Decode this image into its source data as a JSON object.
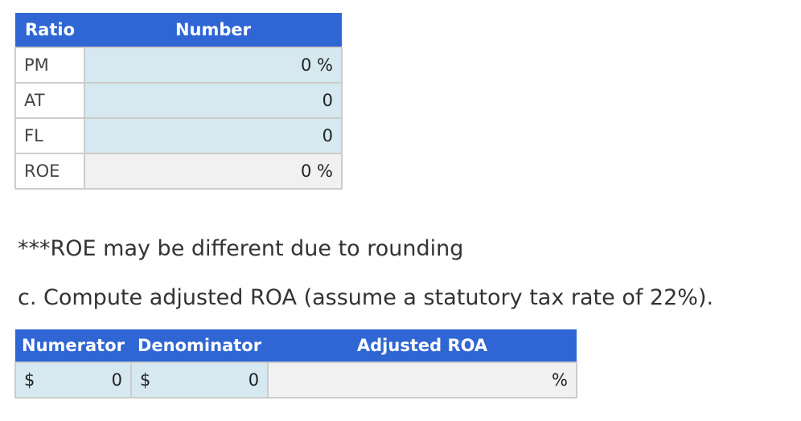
{
  "ratio_table": {
    "headers": {
      "ratio": "Ratio",
      "number": "Number"
    },
    "rows": [
      {
        "label": "PM",
        "value": "0 %",
        "kind": "input"
      },
      {
        "label": "AT",
        "value": "0",
        "kind": "input"
      },
      {
        "label": "FL",
        "value": "0",
        "kind": "input"
      },
      {
        "label": "ROE",
        "value": "0 %",
        "kind": "output"
      }
    ]
  },
  "notes": {
    "rounding": "***ROE may be different due to rounding",
    "question_c": "c. Compute adjusted ROA (assume a statutory tax rate of 22%)."
  },
  "roa_table": {
    "headers": {
      "numerator": "Numerator",
      "denominator": "Denominator",
      "adjusted_roa": "Adjusted ROA"
    },
    "numerator": {
      "prefix": "$",
      "value": "0"
    },
    "denominator": {
      "prefix": "$",
      "value": "0"
    },
    "adjusted_roa": {
      "value": "",
      "suffix": "%"
    }
  },
  "colors": {
    "header_bg": "#2F66D3",
    "input_bg": "#D6E8F0",
    "output_bg": "#F1F1F1"
  }
}
